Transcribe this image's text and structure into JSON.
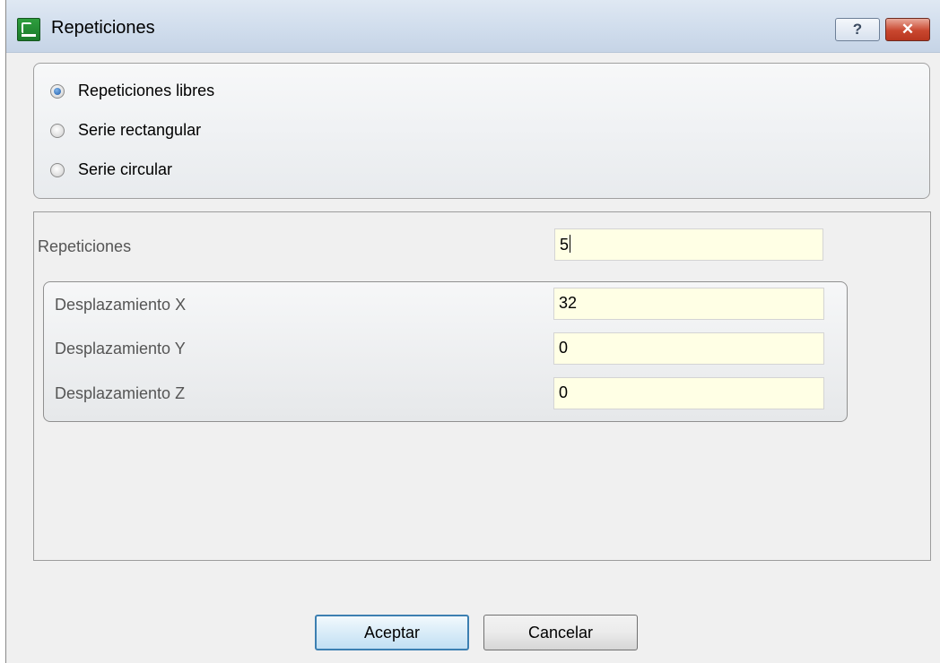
{
  "window": {
    "title": "Repeticiones",
    "help_label": "?",
    "close_label": "✕"
  },
  "mode_options": [
    {
      "label": "Repeticiones libres",
      "selected": true
    },
    {
      "label": "Serie rectangular",
      "selected": false
    },
    {
      "label": "Serie circular",
      "selected": false
    }
  ],
  "fields": {
    "repetitions": {
      "label": "Repeticiones",
      "value": "5"
    },
    "offset_x": {
      "label": "Desplazamiento X",
      "value": "32"
    },
    "offset_y": {
      "label": "Desplazamiento Y",
      "value": "0"
    },
    "offset_z": {
      "label": "Desplazamiento Z",
      "value": "0"
    }
  },
  "buttons": {
    "ok_label": "Aceptar",
    "cancel_label": "Cancelar"
  }
}
